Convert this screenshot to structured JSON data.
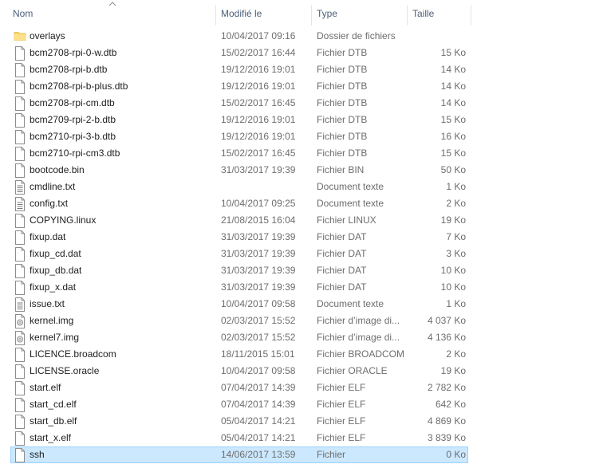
{
  "columns": {
    "name": "Nom",
    "date": "Modifié le",
    "type": "Type",
    "size": "Taille"
  },
  "files": [
    {
      "name": "overlays",
      "date": "10/04/2017 09:16",
      "type": "Dossier de fichiers",
      "size": "",
      "icon": "folder-icon"
    },
    {
      "name": "bcm2708-rpi-0-w.dtb",
      "date": "15/02/2017 16:44",
      "type": "Fichier DTB",
      "size": "15 Ko",
      "icon": "file-icon"
    },
    {
      "name": "bcm2708-rpi-b.dtb",
      "date": "19/12/2016 19:01",
      "type": "Fichier DTB",
      "size": "14 Ko",
      "icon": "file-icon"
    },
    {
      "name": "bcm2708-rpi-b-plus.dtb",
      "date": "19/12/2016 19:01",
      "type": "Fichier DTB",
      "size": "14 Ko",
      "icon": "file-icon"
    },
    {
      "name": "bcm2708-rpi-cm.dtb",
      "date": "15/02/2017 16:45",
      "type": "Fichier DTB",
      "size": "14 Ko",
      "icon": "file-icon"
    },
    {
      "name": "bcm2709-rpi-2-b.dtb",
      "date": "19/12/2016 19:01",
      "type": "Fichier DTB",
      "size": "15 Ko",
      "icon": "file-icon"
    },
    {
      "name": "bcm2710-rpi-3-b.dtb",
      "date": "19/12/2016 19:01",
      "type": "Fichier DTB",
      "size": "16 Ko",
      "icon": "file-icon"
    },
    {
      "name": "bcm2710-rpi-cm3.dtb",
      "date": "15/02/2017 16:45",
      "type": "Fichier DTB",
      "size": "15 Ko",
      "icon": "file-icon"
    },
    {
      "name": "bootcode.bin",
      "date": "31/03/2017 19:39",
      "type": "Fichier BIN",
      "size": "50 Ko",
      "icon": "file-icon"
    },
    {
      "name": "cmdline.txt",
      "date": "",
      "type": "Document texte",
      "size": "1 Ko",
      "icon": "text-file-icon"
    },
    {
      "name": "config.txt",
      "date": "10/04/2017 09:25",
      "type": "Document texte",
      "size": "2 Ko",
      "icon": "text-file-icon"
    },
    {
      "name": "COPYING.linux",
      "date": "21/08/2015 16:04",
      "type": "Fichier LINUX",
      "size": "19 Ko",
      "icon": "file-icon"
    },
    {
      "name": "fixup.dat",
      "date": "31/03/2017 19:39",
      "type": "Fichier DAT",
      "size": "7 Ko",
      "icon": "file-icon"
    },
    {
      "name": "fixup_cd.dat",
      "date": "31/03/2017 19:39",
      "type": "Fichier DAT",
      "size": "3 Ko",
      "icon": "file-icon"
    },
    {
      "name": "fixup_db.dat",
      "date": "31/03/2017 19:39",
      "type": "Fichier DAT",
      "size": "10 Ko",
      "icon": "file-icon"
    },
    {
      "name": "fixup_x.dat",
      "date": "31/03/2017 19:39",
      "type": "Fichier DAT",
      "size": "10 Ko",
      "icon": "file-icon"
    },
    {
      "name": "issue.txt",
      "date": "10/04/2017 09:58",
      "type": "Document texte",
      "size": "1 Ko",
      "icon": "text-file-icon"
    },
    {
      "name": "kernel.img",
      "date": "02/03/2017 15:52",
      "type": "Fichier d’image di...",
      "size": "4 037 Ko",
      "icon": "disk-image-icon"
    },
    {
      "name": "kernel7.img",
      "date": "02/03/2017 15:52",
      "type": "Fichier d’image di...",
      "size": "4 136 Ko",
      "icon": "disk-image-icon"
    },
    {
      "name": "LICENCE.broadcom",
      "date": "18/11/2015 15:01",
      "type": "Fichier BROADCOM",
      "size": "2 Ko",
      "icon": "file-icon"
    },
    {
      "name": "LICENSE.oracle",
      "date": "10/04/2017 09:58",
      "type": "Fichier ORACLE",
      "size": "19 Ko",
      "icon": "file-icon"
    },
    {
      "name": "start.elf",
      "date": "07/04/2017 14:39",
      "type": "Fichier ELF",
      "size": "2 782 Ko",
      "icon": "file-icon"
    },
    {
      "name": "start_cd.elf",
      "date": "07/04/2017 14:39",
      "type": "Fichier ELF",
      "size": "642 Ko",
      "icon": "file-icon"
    },
    {
      "name": "start_db.elf",
      "date": "05/04/2017 14:21",
      "type": "Fichier ELF",
      "size": "4 869 Ko",
      "icon": "file-icon"
    },
    {
      "name": "start_x.elf",
      "date": "05/04/2017 14:21",
      "type": "Fichier ELF",
      "size": "3 839 Ko",
      "icon": "file-icon"
    },
    {
      "name": "ssh",
      "date": "14/06/2017 13:59",
      "type": "Fichier",
      "size": "0 Ko",
      "icon": "file-icon",
      "selected": true
    }
  ],
  "colors": {
    "header_text": "#4c607a",
    "selection_bg": "#cce8ff",
    "selection_border": "#99d1ff",
    "folder": "#ffd866"
  }
}
